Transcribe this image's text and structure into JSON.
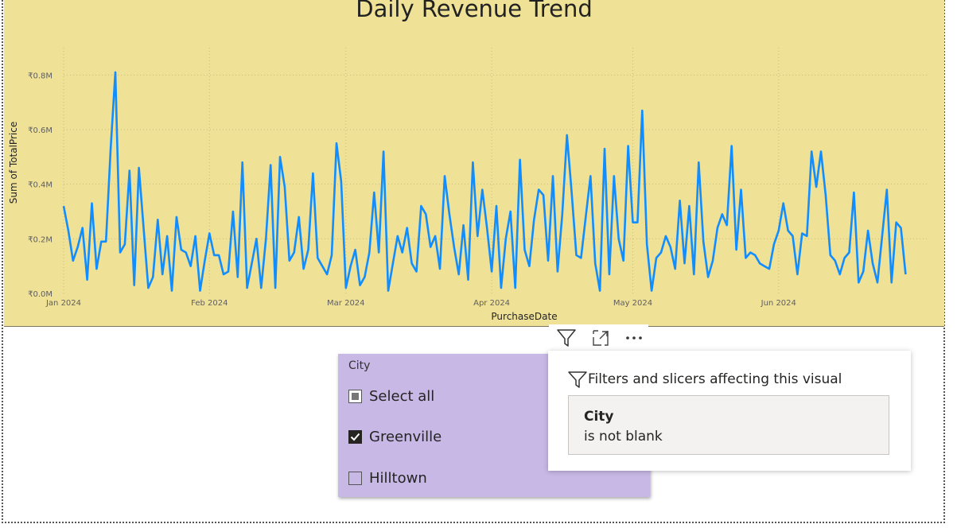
{
  "chart": {
    "title": "Daily Revenue Trend",
    "xlabel": "PurchaseDate",
    "ylabel": "Sum of TotalPrice"
  },
  "chart_data": {
    "type": "line",
    "title": "Daily Revenue Trend",
    "xlabel": "PurchaseDate",
    "ylabel": "Sum of TotalPrice",
    "ylim": [
      0,
      0.9
    ],
    "yticks": [
      0,
      0.2,
      0.4,
      0.6,
      0.8
    ],
    "ytick_labels": [
      "₹0.0M",
      "₹0.2M",
      "₹0.4M",
      "₹0.6M",
      "₹0.8M"
    ],
    "xticks": [
      "2024-01-01",
      "2024-02-01",
      "2024-03-01",
      "2024-04-01",
      "2024-05-01",
      "2024-06-01"
    ],
    "xtick_labels": [
      "Jan 2024",
      "Feb 2024",
      "Mar 2024",
      "Apr 2024",
      "May 2024",
      "Jun 2024"
    ],
    "x_start": "2024-01-01",
    "x_end": "2024-07-03",
    "grid": true,
    "line_color": "#118dff",
    "series": [
      {
        "values": [
          0.32,
          0.23,
          0.12,
          0.17,
          0.24,
          0.05,
          0.33,
          0.09,
          0.19,
          0.19,
          0.53,
          0.81,
          0.15,
          0.18,
          0.45,
          0.03,
          0.46,
          0.24,
          0.02,
          0.06,
          0.27,
          0.07,
          0.21,
          0.01,
          0.28,
          0.16,
          0.15,
          0.1,
          0.21,
          0.01,
          0.12,
          0.22,
          0.14,
          0.14,
          0.07,
          0.08,
          0.3,
          0.06,
          0.48,
          0.02,
          0.11,
          0.2,
          0.02,
          0.2,
          0.47,
          0.02,
          0.5,
          0.39,
          0.12,
          0.15,
          0.28,
          0.09,
          0.16,
          0.44,
          0.13,
          0.1,
          0.07,
          0.14,
          0.55,
          0.41,
          0.02,
          0.1,
          0.16,
          0.03,
          0.06,
          0.15,
          0.37,
          0.15,
          0.52,
          0.01,
          0.11,
          0.21,
          0.15,
          0.24,
          0.11,
          0.08,
          0.32,
          0.29,
          0.17,
          0.21,
          0.09,
          0.43,
          0.29,
          0.17,
          0.07,
          0.25,
          0.05,
          0.48,
          0.21,
          0.38,
          0.24,
          0.08,
          0.32,
          0.02,
          0.2,
          0.3,
          0.02,
          0.49,
          0.16,
          0.1,
          0.27,
          0.38,
          0.36,
          0.12,
          0.43,
          0.08,
          0.29,
          0.58,
          0.37,
          0.14,
          0.13,
          0.28,
          0.43,
          0.11,
          0.01,
          0.53,
          0.07,
          0.43,
          0.2,
          0.12,
          0.54,
          0.26,
          0.26,
          0.67,
          0.18,
          0.01,
          0.13,
          0.15,
          0.21,
          0.17,
          0.09,
          0.34,
          0.11,
          0.32,
          0.07,
          0.48,
          0.19,
          0.06,
          0.12,
          0.24,
          0.29,
          0.25,
          0.54,
          0.16,
          0.38,
          0.13,
          0.15,
          0.14,
          0.11,
          0.1,
          0.09,
          0.18,
          0.23,
          0.33,
          0.23,
          0.21,
          0.07,
          0.22,
          0.21,
          0.52,
          0.39,
          0.52,
          0.36,
          0.14,
          0.12,
          0.07,
          0.13,
          0.15,
          0.37,
          0.04,
          0.08,
          0.23,
          0.11,
          0.04,
          0.21,
          0.38,
          0.04,
          0.26,
          0.24,
          0.07
        ]
      }
    ]
  },
  "visual_header": {
    "filter_icon": "filter-icon",
    "focus_icon": "focus-mode-icon",
    "more_icon": "more-options-icon"
  },
  "slicer": {
    "title": "City",
    "items": [
      {
        "label": "Select all",
        "state": "partial"
      },
      {
        "label": "Greenville",
        "state": "checked"
      },
      {
        "label": "Hilltown",
        "state": "unchecked"
      }
    ]
  },
  "filter_flyout": {
    "heading": "Filters and slicers affecting this visual",
    "field": "City",
    "condition": "is not blank"
  },
  "colors": {
    "chart_bg": "#efe196",
    "slicer_bg": "#c8b8e6",
    "line": "#118dff"
  }
}
